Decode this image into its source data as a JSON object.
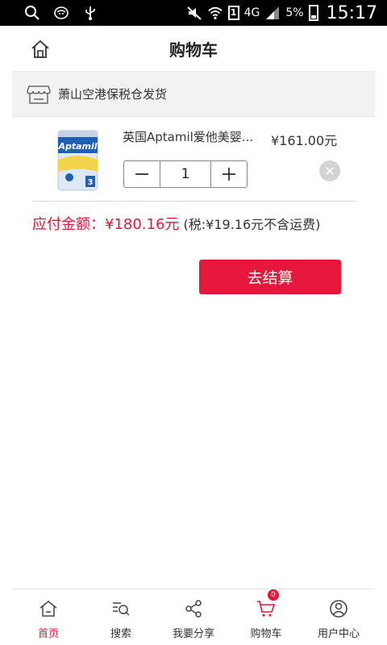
{
  "status_bar": {
    "network": "4G",
    "sim": "1",
    "battery": "5%",
    "time": "15:17"
  },
  "header": {
    "title": "购物车"
  },
  "store": {
    "name": "萧山空港保税仓发货"
  },
  "cart_items": [
    {
      "name": "英国Aptamil爱他美婴...",
      "price": "¥161.00元",
      "quantity": "1",
      "image_brand": "Aptamil",
      "image_stage": "3"
    }
  ],
  "summary": {
    "label": "应付金额：",
    "amount": "¥180.16元",
    "tax_note": "(税:¥19.16元不含运费)"
  },
  "checkout": {
    "label": "去结算"
  },
  "bottom_nav": [
    {
      "label": "首页",
      "icon": "home-icon",
      "active": true
    },
    {
      "label": "搜索",
      "icon": "search-icon",
      "active": false
    },
    {
      "label": "我要分享",
      "icon": "share-icon",
      "active": false
    },
    {
      "label": "购物车",
      "icon": "cart-icon",
      "active": false,
      "badge": "0"
    },
    {
      "label": "用户中心",
      "icon": "user-icon",
      "active": false
    }
  ],
  "colors": {
    "accent": "#e5173a",
    "store_bg": "#f2f2f2"
  }
}
